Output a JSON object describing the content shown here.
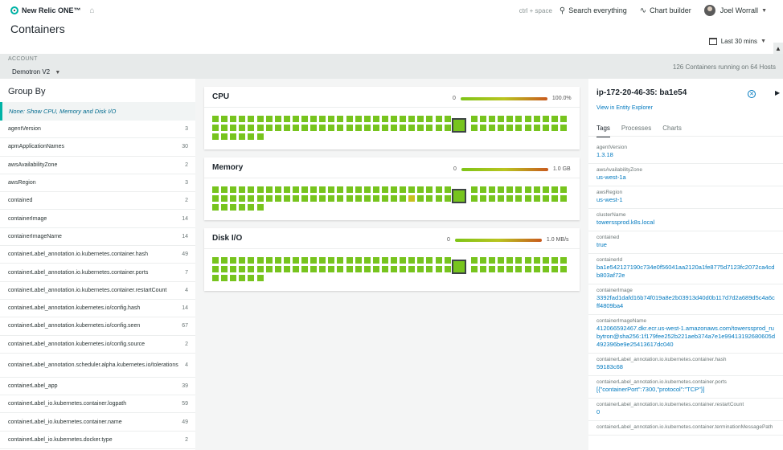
{
  "nav": {
    "brand": "New Relic ONE™",
    "shortcut": "ctrl + space",
    "search_label": "Search everything",
    "chart_builder_label": "Chart builder",
    "user_name": "Joel Worrall"
  },
  "page": {
    "title": "Containers",
    "time_range": "Last 30 mins"
  },
  "account": {
    "label": "ACCOUNT",
    "value": "Demotron V2",
    "summary": "126 Containers running on 64 Hosts"
  },
  "group_by": {
    "title": "Group By",
    "none_label": "None: Show CPU, Memory and Disk I/O",
    "items": [
      {
        "name": "agentVersion",
        "count": "3"
      },
      {
        "name": "apmApplicationNames",
        "count": "30"
      },
      {
        "name": "awsAvailabilityZone",
        "count": "2"
      },
      {
        "name": "awsRegion",
        "count": "3"
      },
      {
        "name": "contained",
        "count": "2"
      },
      {
        "name": "containerImage",
        "count": "14"
      },
      {
        "name": "containerImageName",
        "count": "14"
      },
      {
        "name": "containerLabel_annotation.io.kubernetes.container.hash",
        "count": "49"
      },
      {
        "name": "containerLabel_annotation.io.kubernetes.container.ports",
        "count": "7"
      },
      {
        "name": "containerLabel_annotation.io.kubernetes.container.restartCount",
        "count": "4"
      },
      {
        "name": "containerLabel_annotation.kubernetes.io/config.hash",
        "count": "14"
      },
      {
        "name": "containerLabel_annotation.kubernetes.io/config.seen",
        "count": "67"
      },
      {
        "name": "containerLabel_annotation.kubernetes.io/config.source",
        "count": "2"
      },
      {
        "name": "containerLabel_annotation.scheduler.alpha.kubernetes.io/tolerations",
        "count": "4"
      },
      {
        "name": "containerLabel_app",
        "count": "39"
      },
      {
        "name": "containerLabel_io.kubernetes.container.logpath",
        "count": "59"
      },
      {
        "name": "containerLabel_io.kubernetes.container.name",
        "count": "49"
      },
      {
        "name": "containerLabel_io.kubernetes.docker.type",
        "count": "2"
      }
    ]
  },
  "metrics": {
    "cpu": {
      "title": "CPU",
      "min": "0",
      "max": "100.0%"
    },
    "memory": {
      "title": "Memory",
      "min": "0",
      "max": "1.0 GB"
    },
    "disk": {
      "title": "Disk I/O",
      "min": "0",
      "max": "1.0 MB/s"
    }
  },
  "colors": {
    "healthy": "#77c41e",
    "warning": "#c7c01f",
    "accent": "#00b3a6",
    "link": "#0079bf"
  },
  "detail": {
    "title": "ip-172-20-46-35: ba1e54",
    "entity_link": "View in Entity Explorer",
    "tabs": [
      "Tags",
      "Processes",
      "Charts"
    ],
    "fields": [
      {
        "key": "agentVersion",
        "value": "1.3.18"
      },
      {
        "key": "awsAvailabilityZone",
        "value": "us-west-1a"
      },
      {
        "key": "awsRegion",
        "value": "us-west-1"
      },
      {
        "key": "clusterName",
        "value": "towerssprod.k8s.local"
      },
      {
        "key": "contained",
        "value": "true"
      },
      {
        "key": "containerId",
        "value": "ba1e542127190c734e0f56041aa2120a1fe8775d7123fc2072ca4cdb803af72e"
      },
      {
        "key": "containerImage",
        "value": "3392fad1dafd16b74f019a8e2b03913d40d0b117d7d2a689d5c4a6cff4809ba4"
      },
      {
        "key": "containerImageName",
        "value": "412066592467.dkr.ecr.us-west-1.amazonaws.com/towerssprod_rubytron@sha256:1f179fee252b221aeb374a7e1e99413192680605d492396be9e25413617dc040"
      },
      {
        "key": "containerLabel_annotation.io.kubernetes.container.hash",
        "value": "59183c68"
      },
      {
        "key": "containerLabel_annotation.io.kubernetes.container.ports",
        "value": "[{\"containerPort\":7300,\"protocol\":\"TCP\"}]"
      },
      {
        "key": "containerLabel_annotation.io.kubernetes.container.restartCount",
        "value": "0"
      },
      {
        "key": "containerLabel_annotation.io.kubernetes.container.terminationMessagePath",
        "value": ""
      }
    ]
  }
}
